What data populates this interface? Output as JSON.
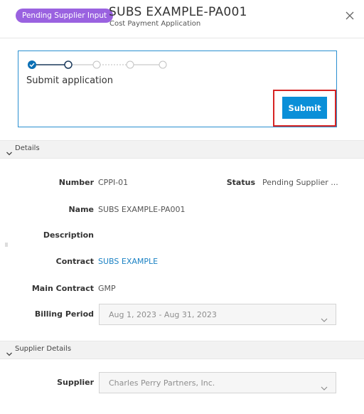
{
  "header": {
    "badge": "Pending Supplier Input",
    "title": "SUBS EXAMPLE-PA001",
    "subtitle": "Cost Payment Application"
  },
  "icons": {
    "close": "close-icon",
    "chevron_down": "chevron-down-icon",
    "step_done": "check-circle-icon",
    "drag_handle": "drag-handle-icon"
  },
  "workflow": {
    "steps_completed": 1,
    "current_step": 2,
    "total_steps": 5,
    "heading": "Submit application",
    "submit_label": "Submit"
  },
  "details": {
    "section_label": "Details",
    "number_label": "Number",
    "number_value": "CPPI-01",
    "status_label": "Status",
    "status_value": "Pending Supplier ...",
    "name_label": "Name",
    "name_value": "SUBS EXAMPLE-PA001",
    "description_label": "Description",
    "description_value": "",
    "contract_label": "Contract",
    "contract_value": "SUBS EXAMPLE",
    "main_contract_label": "Main Contract",
    "main_contract_value": "GMP",
    "billing_period_label": "Billing Period",
    "billing_period_value": "Aug 1, 2023 - Aug 31, 2023"
  },
  "supplier_details": {
    "section_label": "Supplier Details",
    "supplier_label": "Supplier",
    "supplier_value": "Charles Perry Partners, Inc."
  },
  "colors": {
    "badge": "#9a62e0",
    "accent": "#0a8fd8",
    "card_border": "#2a8fd0",
    "highlight": "#d62424",
    "link": "#1b82c4"
  }
}
